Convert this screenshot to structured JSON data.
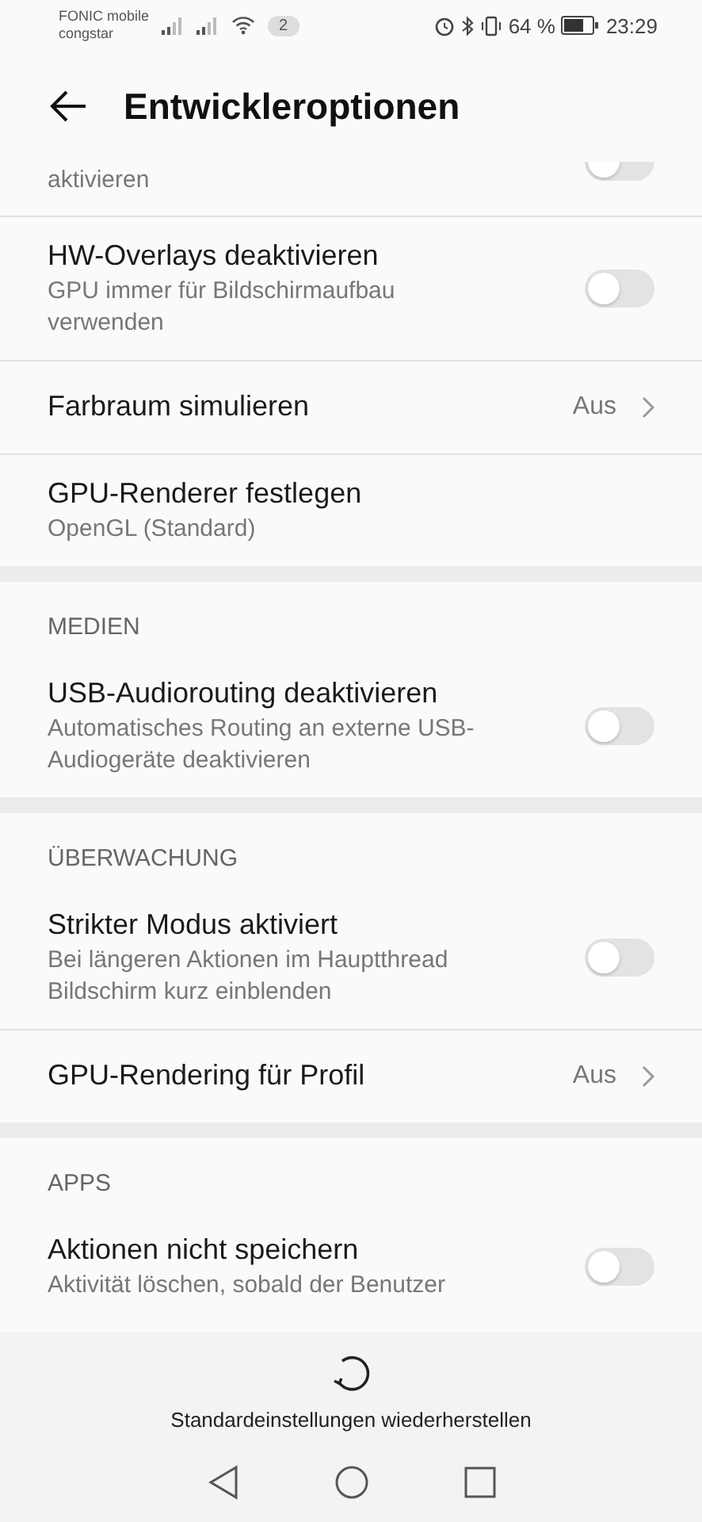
{
  "status_bar": {
    "carriers": [
      "FONIC mobile",
      "congstar"
    ],
    "notifications": "2",
    "battery_text": "64 %",
    "time": "23:29"
  },
  "header": {
    "title": "Entwickleroptionen"
  },
  "sections": [
    {
      "items": [
        {
          "kind": "toggle",
          "summary": "aktivieren",
          "on": false
        },
        {
          "kind": "toggle",
          "title": "HW-Overlays deaktivieren",
          "summary": "GPU immer für Bildschirmaufbau verwenden",
          "on": false
        },
        {
          "kind": "value",
          "title": "Farbraum simulieren",
          "value": "Aus"
        },
        {
          "kind": "text",
          "title": "GPU-Renderer festlegen",
          "summary": "OpenGL (Standard)"
        }
      ]
    },
    {
      "title": "MEDIEN",
      "items": [
        {
          "kind": "toggle",
          "title": "USB-Audiorouting deaktivieren",
          "summary": "Automatisches Routing an externe USB-Audiogeräte deaktivieren",
          "on": false
        }
      ]
    },
    {
      "title": "ÜBERWACHUNG",
      "items": [
        {
          "kind": "toggle",
          "title": "Strikter Modus aktiviert",
          "summary": "Bei längeren Aktionen im Hauptthread Bildschirm kurz einblenden",
          "on": false
        },
        {
          "kind": "value",
          "title": "GPU-Rendering für Profil",
          "value": "Aus"
        }
      ]
    },
    {
      "title": "APPS",
      "items": [
        {
          "kind": "toggle",
          "title": "Aktionen nicht speichern",
          "summary": "Aktivität löschen, sobald der Benutzer",
          "on": false
        }
      ]
    }
  ],
  "restore_button": {
    "label": "Standardeinstellungen wiederherstellen"
  }
}
